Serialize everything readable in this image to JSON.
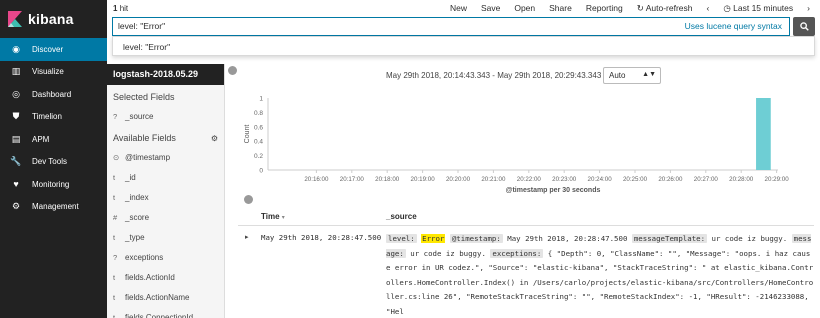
{
  "app": {
    "name": "kibana"
  },
  "nav": [
    {
      "label": "Discover",
      "icon": "compass-icon",
      "active": true
    },
    {
      "label": "Visualize",
      "icon": "bar-chart-icon"
    },
    {
      "label": "Dashboard",
      "icon": "dashboard-icon"
    },
    {
      "label": "Timelion",
      "icon": "shield-icon"
    },
    {
      "label": "APM",
      "icon": "apm-icon"
    },
    {
      "label": "Dev Tools",
      "icon": "wrench-icon"
    },
    {
      "label": "Monitoring",
      "icon": "heart-icon"
    },
    {
      "label": "Management",
      "icon": "gear-icon"
    }
  ],
  "topbar": {
    "hits_count": "1",
    "hits_label": "hit",
    "menu": {
      "new": "New",
      "save": "Save",
      "open": "Open",
      "share": "Share",
      "reporting": "Reporting",
      "autorefresh": "Auto-refresh",
      "timerange": "Last 15 minutes"
    }
  },
  "query": {
    "value": "level: \"Error\"",
    "hint": "Uses lucene query syntax",
    "suggestion": "level: \"Error\""
  },
  "sidebar": {
    "index": "logstash-2018.05.29",
    "selected_title": "Selected Fields",
    "selected": [
      {
        "type": "?",
        "name": "_source"
      }
    ],
    "available_title": "Available Fields",
    "available": [
      {
        "type": "⊙",
        "name": "@timestamp"
      },
      {
        "type": "t",
        "name": "_id"
      },
      {
        "type": "t",
        "name": "_index"
      },
      {
        "type": "#",
        "name": "_score"
      },
      {
        "type": "t",
        "name": "_type"
      },
      {
        "type": "?",
        "name": "exceptions"
      },
      {
        "type": "t",
        "name": "fields.ActionId"
      },
      {
        "type": "t",
        "name": "fields.ActionName"
      },
      {
        "type": "t",
        "name": "fields.ConnectionId"
      }
    ]
  },
  "histogram": {
    "range_text": "May 29th 2018, 20:14:43.343 - May 29th 2018, 20:29:43.343 —",
    "interval": "Auto"
  },
  "chart_data": {
    "type": "bar",
    "ylabel": "Count",
    "xlabel": "@timestamp per 30 seconds",
    "ylim": [
      0,
      1
    ],
    "yticks": [
      "0",
      "0.2",
      "0.4",
      "0.6",
      "0.8",
      "1"
    ],
    "xticks": [
      "20:16:00",
      "20:17:00",
      "20:18:00",
      "20:19:00",
      "20:20:00",
      "20:21:00",
      "20:22:00",
      "20:23:00",
      "20:24:00",
      "20:25:00",
      "20:26:00",
      "20:27:00",
      "20:28:00",
      "20:29:00"
    ],
    "bars": [
      {
        "x": "20:28:30",
        "value": 1
      }
    ],
    "bar_color": "#6eced4",
    "now_marker": "20:29:43",
    "now_color": "#e7664c"
  },
  "doc_table": {
    "headers": {
      "time": "Time",
      "source": "_source"
    },
    "rows": [
      {
        "time": "May 29th 2018, 20:28:47.500",
        "source": [
          {
            "k": "level:",
            "v": "Error",
            "hl": true
          },
          {
            "k": "@timestamp:",
            "v": "May 29th 2018, 20:28:47.500"
          },
          {
            "k": "messageTemplate:",
            "v": "ur code iz buggy."
          },
          {
            "k": "message:",
            "v": "ur code iz buggy."
          },
          {
            "k": "exceptions:",
            "v": "{ \"Depth\": 0, \"ClassName\": \"\", \"Message\": \"oops. i haz cause error in UR codez.\", \"Source\": \"elastic-kibana\", \"StackTraceString\": \" at elastic_kibana.Controllers.HomeController.Index() in /Users/carlo/projects/elastic-kibana/src/Controllers/HomeController.cs:line 26\", \"RemoteStackTraceString\": \"\", \"RemoteStackIndex\": -1, \"HResult\": -2146233088, \"Hel"
          }
        ]
      }
    ]
  }
}
